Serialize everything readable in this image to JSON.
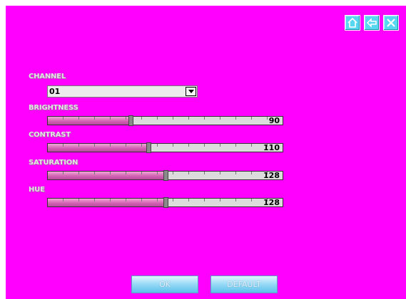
{
  "channel": {
    "label": "CHANNEL",
    "value": "01"
  },
  "sliders": [
    {
      "label": "BRIGHTNESS",
      "value": "90",
      "fraction": 0.354
    },
    {
      "label": "CONTRAST",
      "value": "110",
      "fraction": 0.43
    },
    {
      "label": "SATURATION",
      "value": "128",
      "fraction": 0.5
    },
    {
      "label": "HUE",
      "value": "128",
      "fraction": 0.5
    }
  ],
  "buttons": {
    "ok": "OK",
    "default": "DEFAULT"
  },
  "icons": [
    "home-icon",
    "back-arrow-icon",
    "close-icon"
  ],
  "colors": {
    "background": "#ff00ff",
    "accent": "#58d8f0"
  }
}
